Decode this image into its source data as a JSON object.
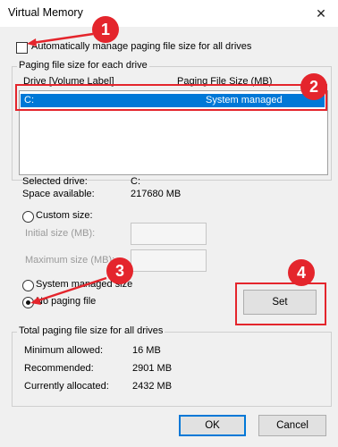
{
  "window": {
    "title": "Virtual Memory"
  },
  "auto_manage": {
    "label": "Automatically manage paging file size for all drives",
    "checked": false
  },
  "per_drive": {
    "legend": "Paging file size for each drive",
    "col_drive": "Drive  [Volume Label]",
    "col_size": "Paging File Size (MB)",
    "rows": [
      {
        "drive": "C:",
        "size": "System managed"
      }
    ]
  },
  "selected": {
    "drive_label": "Selected drive:",
    "drive_value": "C:",
    "space_label": "Space available:",
    "space_value": "217680 MB"
  },
  "options": {
    "custom_label": "Custom size:",
    "initial_label": "Initial size (MB):",
    "maximum_label": "Maximum size (MB):",
    "system_label": "System managed size",
    "none_label": "No paging file",
    "selected": "none"
  },
  "set_button": "Set",
  "total": {
    "legend": "Total paging file size for all drives",
    "min_label": "Minimum allowed:",
    "min_value": "16 MB",
    "rec_label": "Recommended:",
    "rec_value": "2901 MB",
    "cur_label": "Currently allocated:",
    "cur_value": "2432 MB"
  },
  "ok_button": "OK",
  "cancel_button": "Cancel",
  "annotations": {
    "m1": "1",
    "m2": "2",
    "m3": "3",
    "m4": "4"
  },
  "colors": {
    "marker": "#e4252c",
    "selection": "#0078d7"
  }
}
